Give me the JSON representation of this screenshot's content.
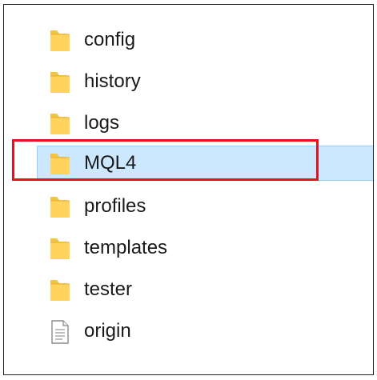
{
  "items": [
    {
      "label": "config",
      "type": "folder",
      "icon": "folder-icon"
    },
    {
      "label": "history",
      "type": "folder",
      "icon": "folder-icon"
    },
    {
      "label": "logs",
      "type": "folder",
      "icon": "folder-icon"
    },
    {
      "label": "MQL4",
      "type": "folder",
      "icon": "folder-icon",
      "selected": true,
      "highlighted": true
    },
    {
      "label": "profiles",
      "type": "folder",
      "icon": "folder-icon"
    },
    {
      "label": "templates",
      "type": "folder",
      "icon": "folder-icon"
    },
    {
      "label": "tester",
      "type": "folder",
      "icon": "folder-icon"
    },
    {
      "label": "origin",
      "type": "file",
      "icon": "document-icon"
    }
  ],
  "colors": {
    "selection_fill": "#cce8ff",
    "selection_border": "#99d1ff",
    "highlight_box": "#e8101d",
    "folder_body": "#ffd35c",
    "folder_back": "#f5c342"
  }
}
